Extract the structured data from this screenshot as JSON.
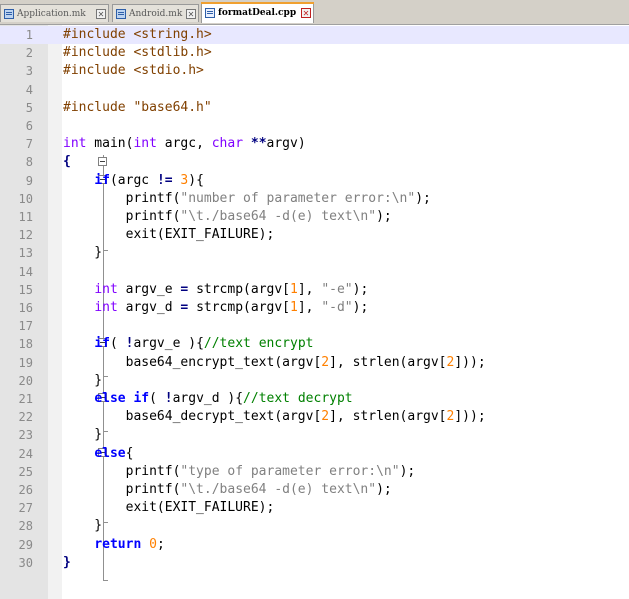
{
  "tabs": [
    {
      "label": "Application.mk",
      "active": false,
      "close": "✕",
      "icon": "file-icon"
    },
    {
      "label": "Android.mk",
      "active": false,
      "close": "✕",
      "icon": "file-icon"
    },
    {
      "label": "formatDeal.cpp",
      "active": true,
      "close": "✕",
      "icon": "file-icon"
    }
  ],
  "colors": {
    "keyword": "#0000ff",
    "type": "#8000ff",
    "preprocessor": "#804000",
    "string": "#808080",
    "number": "#ff8000",
    "comment": "#008000",
    "current_line": "#e8e8ff"
  },
  "editor": {
    "current_line": 1,
    "lines": [
      {
        "n": "1",
        "tokens": [
          [
            "pre",
            "#include <string.h>"
          ]
        ]
      },
      {
        "n": "2",
        "tokens": [
          [
            "pre",
            "#include <stdlib.h>"
          ]
        ]
      },
      {
        "n": "3",
        "tokens": [
          [
            "pre",
            "#include <stdio.h>"
          ]
        ]
      },
      {
        "n": "4",
        "tokens": []
      },
      {
        "n": "5",
        "tokens": [
          [
            "pre",
            "#include \"base64.h\""
          ]
        ]
      },
      {
        "n": "6",
        "tokens": []
      },
      {
        "n": "7",
        "tokens": [
          [
            "type",
            "int"
          ],
          [
            "id",
            " main("
          ],
          [
            "type",
            "int"
          ],
          [
            "id",
            " argc, "
          ],
          [
            "type",
            "char"
          ],
          [
            "id",
            " "
          ],
          [
            "op",
            "**"
          ],
          [
            "id",
            "argv)"
          ]
        ]
      },
      {
        "n": "8",
        "tokens": [
          [
            "op",
            "{"
          ]
        ]
      },
      {
        "n": "9",
        "tokens": [
          [
            "id",
            "    "
          ],
          [
            "kw",
            "if"
          ],
          [
            "id",
            "(argc "
          ],
          [
            "op",
            "!="
          ],
          [
            "id",
            " "
          ],
          [
            "num",
            "3"
          ],
          [
            "id",
            "){"
          ]
        ]
      },
      {
        "n": "10",
        "tokens": [
          [
            "id",
            "        printf("
          ],
          [
            "str",
            "\"number of parameter error:\\n\""
          ],
          [
            "id",
            ");"
          ]
        ]
      },
      {
        "n": "11",
        "tokens": [
          [
            "id",
            "        printf("
          ],
          [
            "str",
            "\"\\t./base64 -d(e) text\\n\""
          ],
          [
            "id",
            ");"
          ]
        ]
      },
      {
        "n": "12",
        "tokens": [
          [
            "id",
            "        exit(EXIT_FAILURE);"
          ]
        ]
      },
      {
        "n": "13",
        "tokens": [
          [
            "id",
            "    }"
          ]
        ]
      },
      {
        "n": "14",
        "tokens": []
      },
      {
        "n": "15",
        "tokens": [
          [
            "id",
            "    "
          ],
          [
            "type",
            "int"
          ],
          [
            "id",
            " argv_e "
          ],
          [
            "op",
            "="
          ],
          [
            "id",
            " strcmp(argv["
          ],
          [
            "num",
            "1"
          ],
          [
            "id",
            "], "
          ],
          [
            "str",
            "\"-e\""
          ],
          [
            "id",
            ");"
          ]
        ]
      },
      {
        "n": "16",
        "tokens": [
          [
            "id",
            "    "
          ],
          [
            "type",
            "int"
          ],
          [
            "id",
            " argv_d "
          ],
          [
            "op",
            "="
          ],
          [
            "id",
            " strcmp(argv["
          ],
          [
            "num",
            "1"
          ],
          [
            "id",
            "], "
          ],
          [
            "str",
            "\"-d\""
          ],
          [
            "id",
            ");"
          ]
        ]
      },
      {
        "n": "17",
        "tokens": []
      },
      {
        "n": "18",
        "tokens": [
          [
            "id",
            "    "
          ],
          [
            "kw",
            "if"
          ],
          [
            "id",
            "( "
          ],
          [
            "op",
            "!"
          ],
          [
            "id",
            "argv_e ){"
          ],
          [
            "cmt",
            "//text encrypt"
          ]
        ]
      },
      {
        "n": "19",
        "tokens": [
          [
            "id",
            "        base64_encrypt_text(argv["
          ],
          [
            "num",
            "2"
          ],
          [
            "id",
            "], strlen(argv["
          ],
          [
            "num",
            "2"
          ],
          [
            "id",
            "]));"
          ]
        ]
      },
      {
        "n": "20",
        "tokens": [
          [
            "id",
            "    }"
          ]
        ]
      },
      {
        "n": "21",
        "tokens": [
          [
            "id",
            "    "
          ],
          [
            "kw",
            "else if"
          ],
          [
            "id",
            "( "
          ],
          [
            "op",
            "!"
          ],
          [
            "id",
            "argv_d ){"
          ],
          [
            "cmt",
            "//text decrypt"
          ]
        ]
      },
      {
        "n": "22",
        "tokens": [
          [
            "id",
            "        base64_decrypt_text(argv["
          ],
          [
            "num",
            "2"
          ],
          [
            "id",
            "], strlen(argv["
          ],
          [
            "num",
            "2"
          ],
          [
            "id",
            "]));"
          ]
        ]
      },
      {
        "n": "23",
        "tokens": [
          [
            "id",
            "    }"
          ]
        ]
      },
      {
        "n": "24",
        "tokens": [
          [
            "id",
            "    "
          ],
          [
            "kw",
            "else"
          ],
          [
            "id",
            "{"
          ]
        ]
      },
      {
        "n": "25",
        "tokens": [
          [
            "id",
            "        printf("
          ],
          [
            "str",
            "\"type of parameter error:\\n\""
          ],
          [
            "id",
            ");"
          ]
        ]
      },
      {
        "n": "26",
        "tokens": [
          [
            "id",
            "        printf("
          ],
          [
            "str",
            "\"\\t./base64 -d(e) text\\n\""
          ],
          [
            "id",
            ");"
          ]
        ]
      },
      {
        "n": "27",
        "tokens": [
          [
            "id",
            "        exit(EXIT_FAILURE);"
          ]
        ]
      },
      {
        "n": "28",
        "tokens": [
          [
            "id",
            "    }"
          ]
        ]
      },
      {
        "n": "29",
        "tokens": [
          [
            "id",
            "    "
          ],
          [
            "kw",
            "return"
          ],
          [
            "id",
            " "
          ],
          [
            "num",
            "0"
          ],
          [
            "id",
            ";"
          ]
        ]
      },
      {
        "n": "30",
        "tokens": [
          [
            "op",
            "}"
          ]
        ]
      }
    ]
  }
}
